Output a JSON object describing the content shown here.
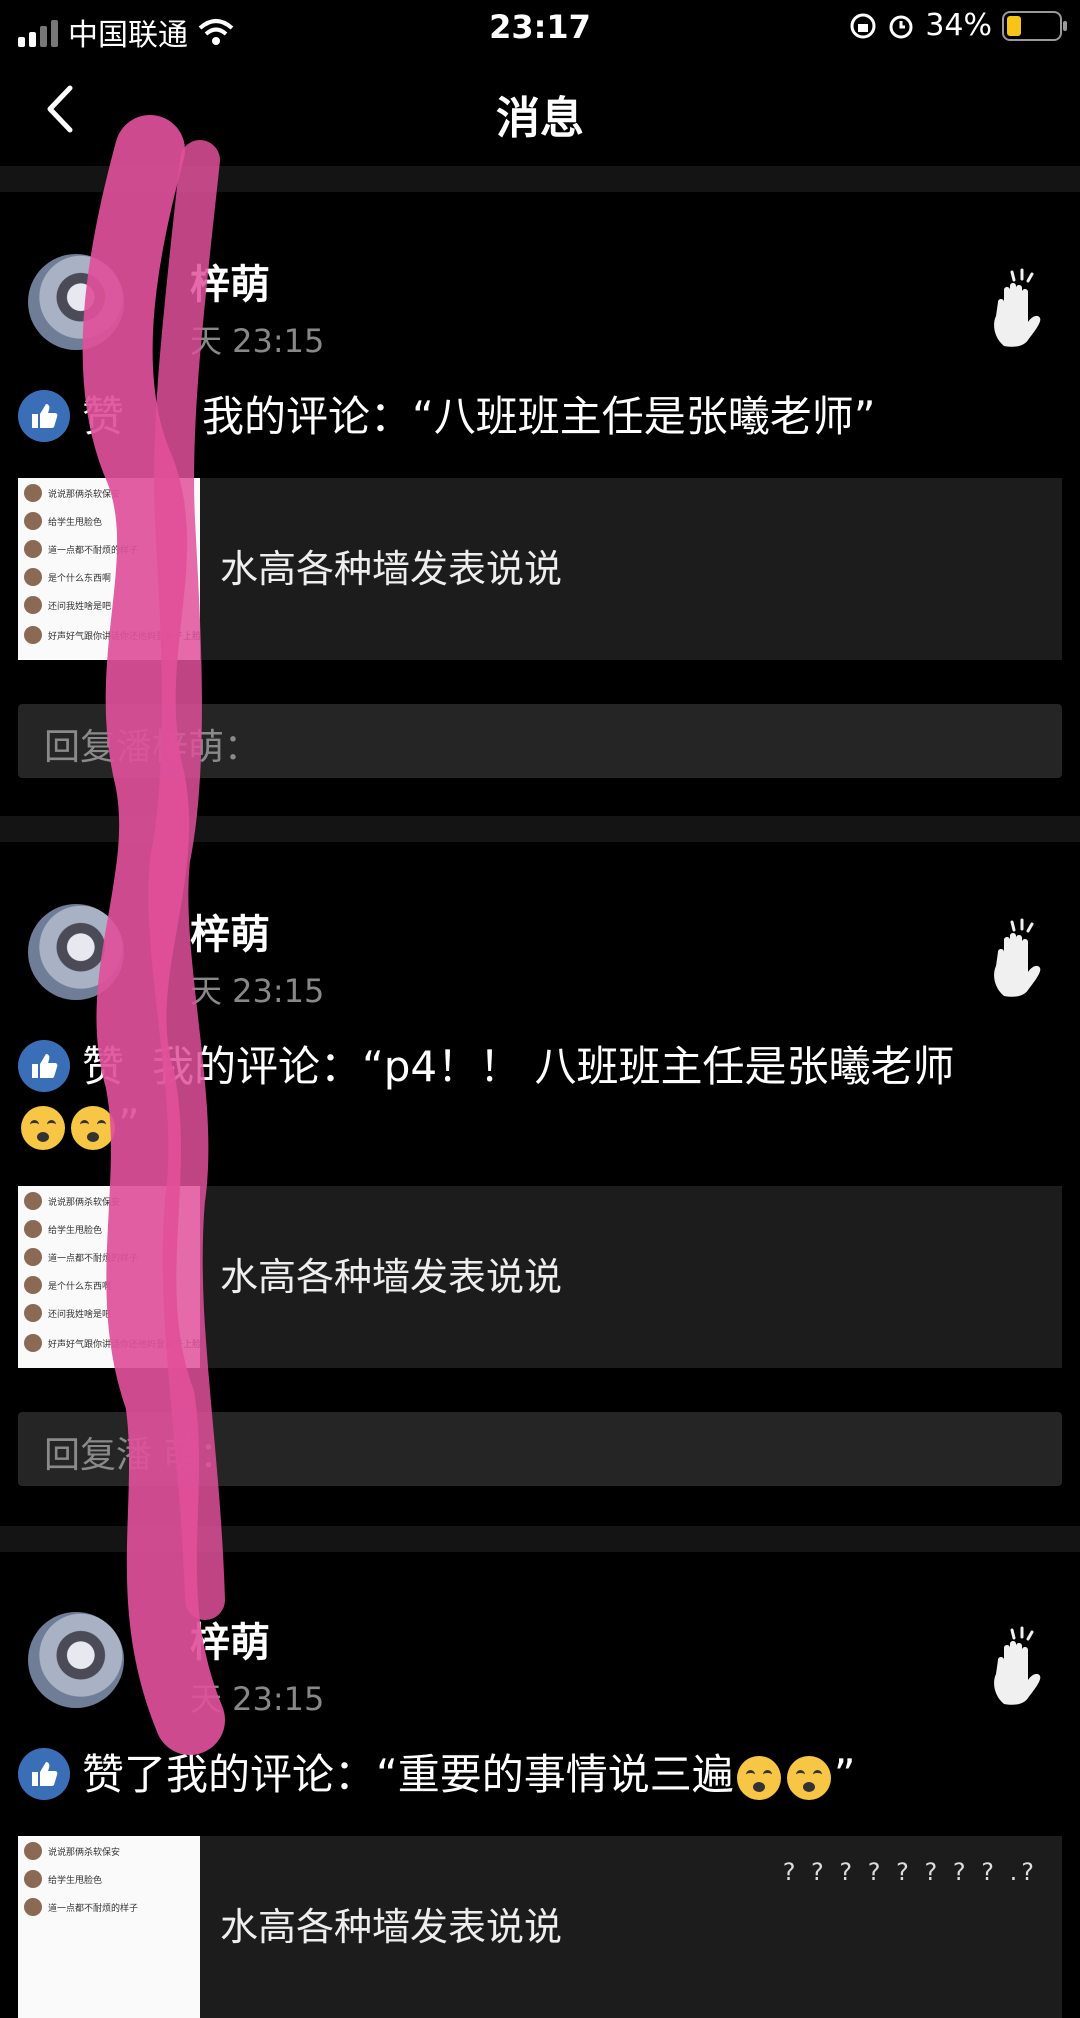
{
  "status_bar": {
    "carrier": "中国联通",
    "time": "23:17",
    "battery": "34%",
    "battery_level": 0.34
  },
  "nav": {
    "title": "消息",
    "back_icon": "chevron-left-icon"
  },
  "messages": [
    {
      "name": "梓萌",
      "time": "天 23:15",
      "like_prefix": "赞",
      "like_text": "我的评论：“八班班主任是张曦老师”",
      "post_text": "水高各种墙发表说说",
      "reply_placeholder": "回复潘梓萌："
    },
    {
      "name": "梓萌",
      "time": "天 23:15",
      "like_prefix": "赞",
      "like_text": "我的评论：“p4！！ 八班班主任是张曦老师",
      "like_suffix": "”",
      "post_text": "水高各种墙发表说说",
      "reply_placeholder": "回复潘   萌："
    },
    {
      "name": "梓萌",
      "time": "天 23:15",
      "like_prefix": "赞了",
      "like_text": "我的评论：“重要的事情说三遍",
      "like_suffix": "”",
      "post_text": "水高各种墙发表说说"
    }
  ],
  "thumb_lines": [
    "说说那俩杀软保安",
    "给学生甩脸色",
    "道一点都不耐烦的样子",
    "是个什么东西啊",
    "还问我姓啥是吧",
    "好声好气跟你讲话你还他妈登鼻子上脸了"
  ],
  "watermark": "? ? ? ? ? ? ? ? .?",
  "colors": {
    "like_badge": "#3a6fb8",
    "censor_mark": "#e0509a"
  }
}
